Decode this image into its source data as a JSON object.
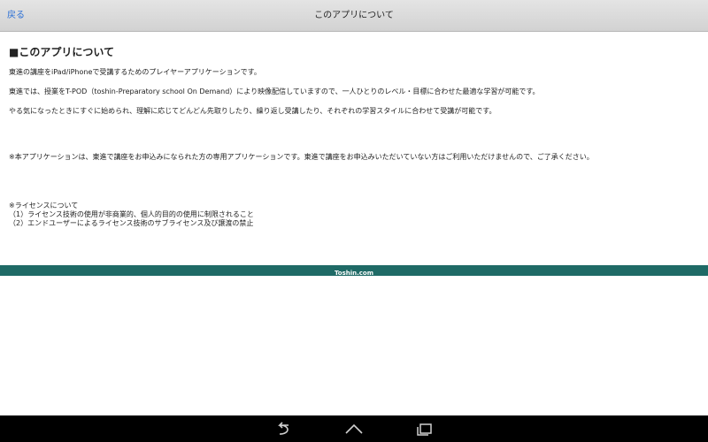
{
  "navbar": {
    "back_label": "戻る",
    "title": "このアプリについて"
  },
  "content": {
    "heading": "■このアプリについて",
    "paragraphs": [
      "東進の講座をiPad/iPhoneで受講するためのプレイヤーアプリケーションです。",
      "東進では、授業をT-POD（toshin-Preparatory school On Demand）により映像配信していますので、一人ひとりのレベル・目標に合わせた最適な学習が可能です。",
      "やる気になったときにすぐに始められ、理解に応じてどんどん先取りしたり、繰り返し受講したり、それぞれの学習スタイルに合わせて受講が可能です。"
    ],
    "notice": "※本アプリケーションは、東進で講座をお申込みになられた方の専用アプリケーションです。東進で講座をお申込みいただいていない方はご利用いただけませんので、ご了承ください。",
    "license": {
      "title": "※ライセンスについて",
      "items": [
        "（1）ライセンス技術の使用が非商業的、個人的目的の使用に制限されること",
        "（2）エンドユーザーによるライセンス技術のサブライセンス及び譲渡の禁止"
      ]
    }
  },
  "footer": {
    "text": "Toshin.com",
    "color": "#1f6a66"
  },
  "system_bar": {
    "icons": [
      "back-icon",
      "home-icon",
      "recent-apps-icon"
    ]
  },
  "colors": {
    "link": "#2a6fd6",
    "navbar_bg": "#dcdcdc"
  }
}
